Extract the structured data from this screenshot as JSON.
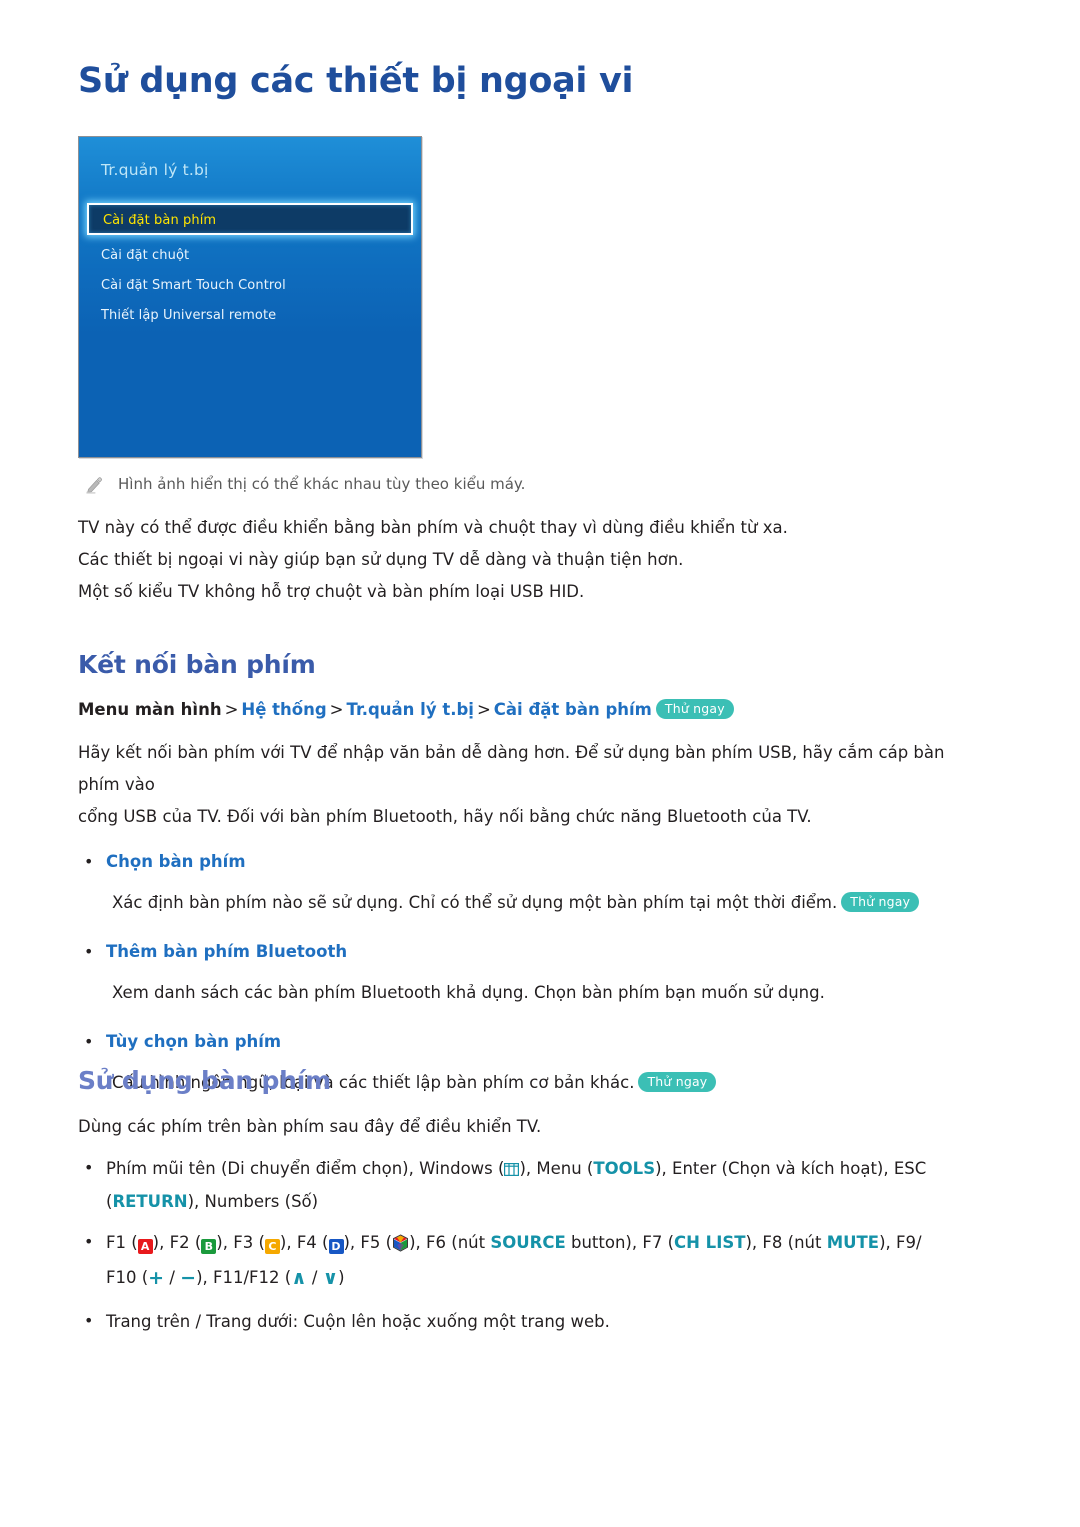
{
  "page": {
    "title": "Sử dụng các thiết bị ngoại vi"
  },
  "tv_panel": {
    "title": "Tr.quản lý t.bị",
    "items": [
      {
        "label": "Cài đặt bàn phím",
        "selected": true
      },
      {
        "label": "Cài đặt chuột",
        "selected": false
      },
      {
        "label": "Cài đặt Smart Touch Control",
        "selected": false
      },
      {
        "label": "Thiết lập Universal remote",
        "selected": false
      }
    ],
    "colors": {
      "panel_top": "#1f8fd8",
      "panel_bottom": "#0c62b4",
      "selected_bg": "#0d3b66",
      "selected_text": "#ffe400",
      "title_text": "#bfe6f7"
    }
  },
  "note": {
    "icon": "pencil-icon",
    "text": "Hình ảnh hiển thị có thể khác nhau tùy theo kiểu máy."
  },
  "intro_paragraphs": [
    "TV này có thể được điều khiển bằng bàn phím và chuột thay vì dùng điều khiển từ xa.",
    "Các thiết bị ngoại vi này giúp bạn sử dụng TV dễ dàng và thuận tiện hơn.",
    "Một số kiểu TV không hỗ trợ chuột và bàn phím loại USB HID."
  ],
  "section_connect": {
    "heading": "Kết nối bàn phím",
    "breadcrumb": {
      "root": "Menu màn hình",
      "separator": ">",
      "items": [
        "Hệ thống",
        "Tr.quản lý t.bị",
        "Cài đặt bàn phím"
      ],
      "badge": "Thử ngay"
    },
    "paragraph_lines": [
      "Hãy kết nối bàn phím với TV để nhập văn bản dễ dàng hơn. Để sử dụng bàn phím USB, hãy cắm cáp bàn phím vào",
      "cổng USB của TV. Đối với bàn phím Bluetooth, hãy nối bằng chức năng Bluetooth của TV."
    ],
    "options": [
      {
        "title": "Chọn bàn phím",
        "description": "Xác định bàn phím nào sẽ sử dụng. Chỉ có thể sử dụng một bàn phím tại một thời điểm.",
        "badge": "Thử ngay"
      },
      {
        "title": "Thêm bàn phím Bluetooth",
        "description": "Xem danh sách các bàn phím Bluetooth khả dụng. Chọn bàn phím bạn muốn sử dụng.",
        "badge": ""
      },
      {
        "title": "Tùy chọn bàn phím",
        "description": "Cấu hình ngôn ngữ, loại và các thiết lập bàn phím cơ bản khác.",
        "badge": "Thử ngay"
      }
    ]
  },
  "section_use": {
    "heading": "Sử dụng bàn phím",
    "intro": "Dùng các phím trên bàn phím sau đây để điều khiển TV.",
    "keys_line1": {
      "a": "Phím mũi tên (Di chuyển điểm chọn), Windows (",
      "b": "), Menu (",
      "tools": "TOOLS",
      "c": "), Enter (Chọn và kích hoạt), ESC",
      "d": "(",
      "return": "RETURN",
      "e": "), Numbers (Số)"
    },
    "keys_line2": {
      "f1": "F1 (",
      "a_key": "A",
      "f2": "), F2 (",
      "b_key": "B",
      "f3": "), F3 (",
      "c_key": "C",
      "f4": "), F4 (",
      "d_key": "D",
      "f5": "), F5 (",
      "f6": "), F6 (nút ",
      "source": "SOURCE",
      "f7_pre": " button), F7 (",
      "chlist": "CH LIST",
      "f8_pre": "), F8 (nút ",
      "mute": "MUTE",
      "f9": "), F9/",
      "f10_pre": "F10 (",
      "plus": "+",
      "slash1": " / ",
      "minus": "−",
      "f11_pre": "), F11/F12 (",
      "up": "∧",
      "slash2": " / ",
      "down": "∨",
      "end": ")"
    },
    "last_bullet": "Trang trên / Trang dưới: Cuộn lên hoặc xuống một trang web."
  },
  "colors": {
    "title_blue": "#1f4e9c",
    "heading_blue": "#3a5baa",
    "heading_light": "#6b7fc7",
    "link_blue": "#1f6fc0",
    "teal": "#1592a8",
    "badge_teal": "#3bbfb5"
  }
}
